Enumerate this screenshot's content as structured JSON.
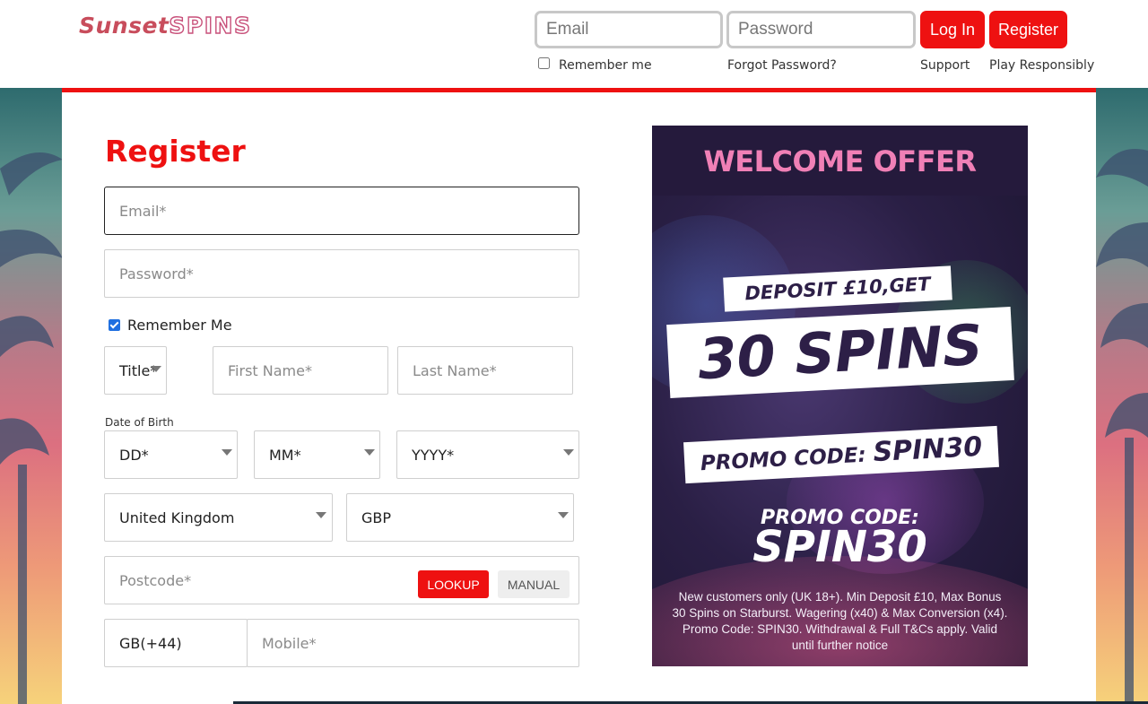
{
  "header": {
    "logo_part1": "Sunset",
    "logo_part2": "SPINS",
    "email_placeholder": "Email",
    "password_placeholder": "Password",
    "login_label": "Log In",
    "register_label": "Register",
    "remember_label": "Remember me",
    "forgot_label": "Forgot Password?",
    "support_label": "Support",
    "responsible_label": "Play Responsibly"
  },
  "form": {
    "title": "Register",
    "email_placeholder": "Email*",
    "password_placeholder": "Password*",
    "remember_label": "Remember Me",
    "remember_checked": true,
    "title_select": "Title*",
    "first_name_placeholder": "First Name*",
    "last_name_placeholder": "Last Name*",
    "dob_label": "Date of Birth",
    "dob_day": "DD*",
    "dob_month": "MM*",
    "dob_year": "YYYY*",
    "country": "United Kingdom",
    "currency": "GBP",
    "postcode_placeholder": "Postcode*",
    "lookup_label": "LOOKUP",
    "manual_label": "MANUAL",
    "phone_code": "GB(+44)",
    "mobile_placeholder": "Mobile*"
  },
  "promo": {
    "heading": "WELCOME OFFER",
    "line1": "DEPOSIT £10,GET",
    "line2": "30 SPINS",
    "line3_prefix": "PROMO CODE:",
    "line3_code": "SPIN30",
    "code_label": "PROMO CODE:",
    "code": "SPIN30",
    "terms": "New customers only (UK 18+). Min Deposit £10, Max Bonus 30 Spins on Starburst. Wagering (x40) & Max Conversion (x4). Promo Code: SPIN30. Withdrawal & Full T&Cs apply. Valid until further notice"
  },
  "colors": {
    "brand_red": "#ee1111",
    "promo_pink": "#f080b6",
    "promo_dark": "#2d1f47"
  }
}
